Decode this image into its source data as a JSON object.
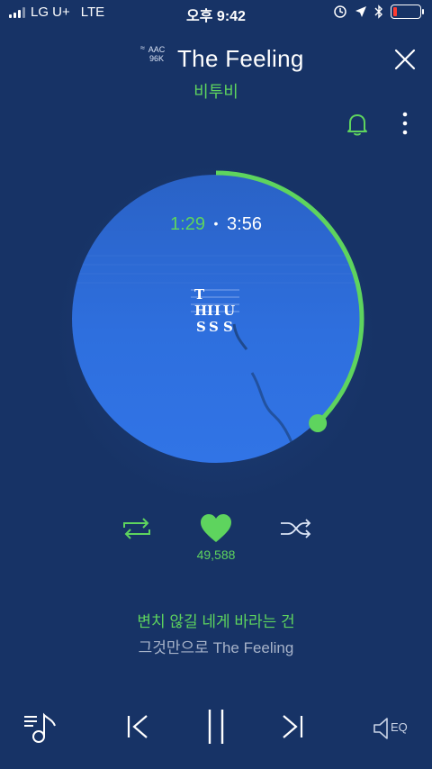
{
  "status_bar": {
    "carrier": "LG U+",
    "network": "LTE",
    "time": "오후 9:42"
  },
  "header": {
    "quality_codec": "AAC",
    "quality_bitrate": "96K",
    "title": "The Feeling",
    "artist": "비투비"
  },
  "player": {
    "current_time": "1:29",
    "separator": "•",
    "total_time": "3:56",
    "progress_fraction": 0.377,
    "album_art_text": [
      "T",
      "H",
      "I",
      "I",
      "U",
      "S",
      "S",
      "S"
    ]
  },
  "actions": {
    "like_count": "49,588"
  },
  "lyrics": {
    "current": "변치 않길 네게 바라는 건",
    "next": "그것만으로 The Feeling"
  },
  "bottom": {
    "eq_label": "EQ"
  },
  "colors": {
    "background": "#173366",
    "accent_green": "#5ed45e",
    "disc_blue": "#2e6fde",
    "battery_low": "#ff3b30"
  },
  "icons": [
    "signal-icon",
    "alarm-lock-icon",
    "location-icon",
    "bluetooth-icon",
    "battery-icon",
    "close-icon",
    "bell-icon",
    "more-vertical-icon",
    "repeat-icon",
    "heart-icon",
    "shuffle-icon",
    "playlist-icon",
    "previous-icon",
    "pause-icon",
    "next-icon",
    "eq-speaker-icon"
  ]
}
